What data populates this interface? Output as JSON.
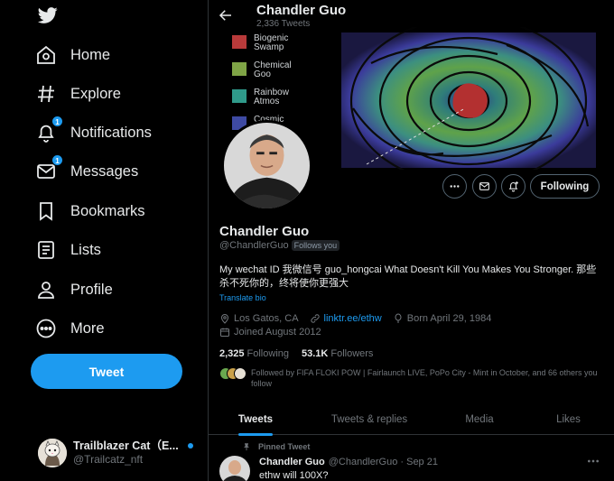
{
  "sidebar": {
    "items": [
      {
        "label": "Home",
        "icon": "home-icon"
      },
      {
        "label": "Explore",
        "icon": "hashtag-icon"
      },
      {
        "label": "Notifications",
        "icon": "bell-icon",
        "badge": "1"
      },
      {
        "label": "Messages",
        "icon": "envelope-icon",
        "badge": "1"
      },
      {
        "label": "Bookmarks",
        "icon": "bookmark-icon"
      },
      {
        "label": "Lists",
        "icon": "list-icon"
      },
      {
        "label": "Profile",
        "icon": "person-icon"
      },
      {
        "label": "More",
        "icon": "more-circle-icon"
      }
    ],
    "tweet_button": "Tweet",
    "account": {
      "name": "Trailblazer Cat（E...",
      "handle": "@Trailcatz_nft"
    }
  },
  "header": {
    "name": "Chandler Guo",
    "tweet_count": "2,336 Tweets"
  },
  "banner_legend": [
    {
      "label": "Biogenic Swamp",
      "color": "#b83a3a"
    },
    {
      "label": "Chemical Goo",
      "color": "#7fa446"
    },
    {
      "label": "Rainbow Atmos",
      "color": "#2f9a8a"
    },
    {
      "label": "Cosmic",
      "color": "#3e4aa3"
    }
  ],
  "profile": {
    "name": "Chandler Guo",
    "handle": "@ChandlerGuo",
    "follows_you": "Follows you",
    "follow_button": "Following",
    "bio": "My wechat ID 我微信号 guo_hongcai  What Doesn't Kill You Makes You Stronger. 那些杀不死你的，终将使你更强大",
    "translate": "Translate bio",
    "location": "Los Gatos, CA",
    "link": "linktr.ee/ethw",
    "born": "Born April 29, 1984",
    "joined": "Joined August 2012",
    "following_count": "2,325",
    "following_label": "Following",
    "followers_count": "53.1K",
    "followers_label": "Followers",
    "followed_by": "Followed by FIFA FLOKI POW | Fairlaunch LIVE, PoPo City - Mint in October, and 66 others you follow"
  },
  "tabs": [
    "Tweets",
    "Tweets & replies",
    "Media",
    "Likes"
  ],
  "pinned_tweet": {
    "label": "Pinned Tweet",
    "name": "Chandler Guo",
    "meta": "@ChandlerGuo · Sep 21",
    "text": "ethw will 100X?"
  },
  "colors": {
    "accent": "#1d9bf0",
    "background": "#000000",
    "text": "#e7e9ea",
    "muted": "#71767b"
  }
}
